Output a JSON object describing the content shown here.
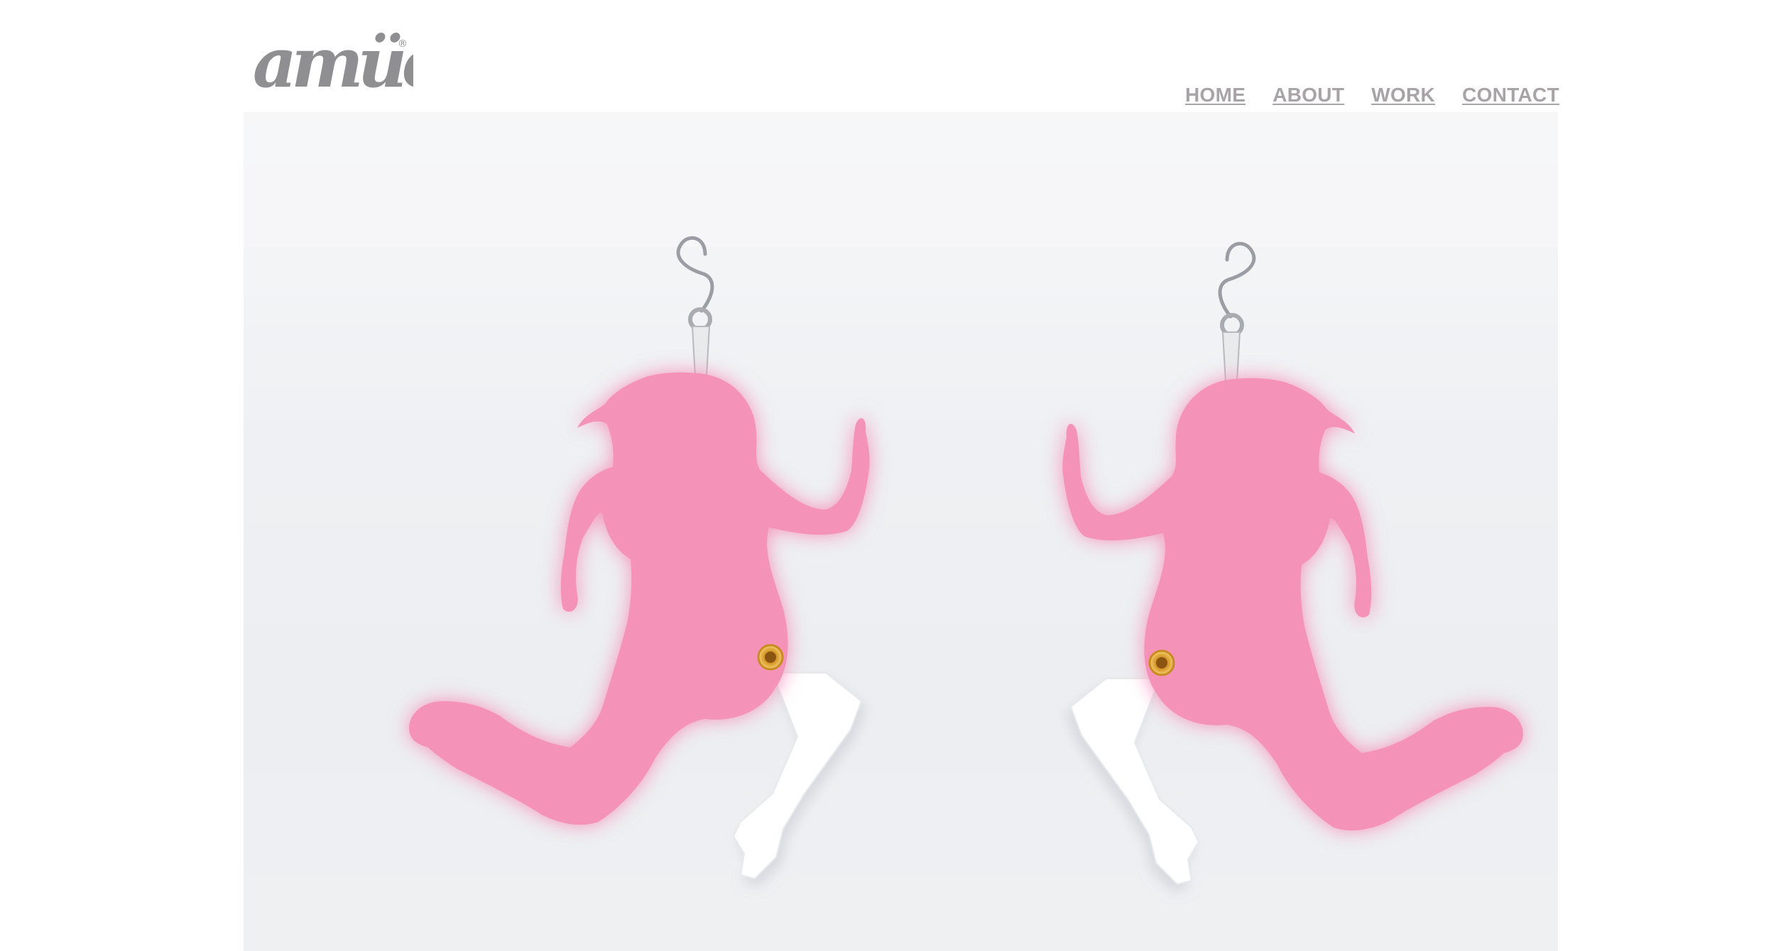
{
  "brand": {
    "logo_text": "amüch",
    "logo_mark": "®"
  },
  "nav": {
    "items": [
      {
        "label": "HOME",
        "name": "nav-home"
      },
      {
        "label": "ABOUT",
        "name": "nav-about"
      },
      {
        "label": "WORK",
        "name": "nav-work"
      },
      {
        "label": "CONTACT",
        "name": "nav-contact"
      }
    ]
  },
  "hero": {
    "subject": "pink-silhouette-earrings-photo"
  },
  "colors": {
    "nav_text": "#a7a3a6",
    "logo": "#8f8f92",
    "earring_pink": "#f48fb5",
    "earring_white": "#ffffff",
    "background": "#ffffff"
  }
}
